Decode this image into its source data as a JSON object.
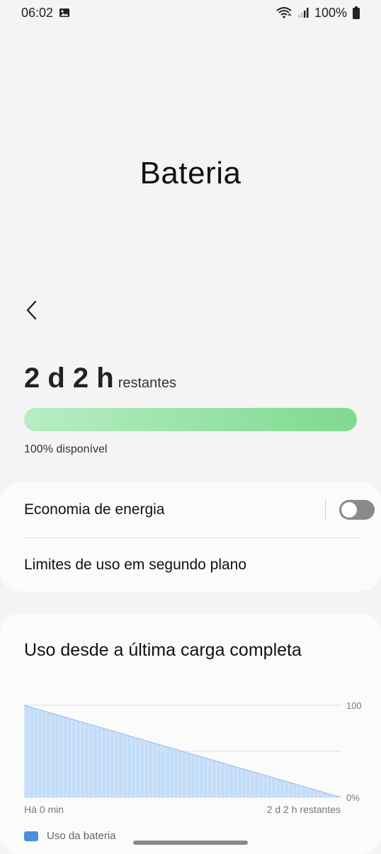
{
  "status_bar": {
    "time": "06:02",
    "battery_percent": "100%",
    "icons": [
      "gallery-notification-icon",
      "wifi-icon",
      "cell-signal-icon",
      "battery-icon"
    ]
  },
  "header": {
    "title": "Bateria",
    "back_icon": "chevron-left-icon"
  },
  "battery": {
    "remaining_value": "2 d 2 h",
    "remaining_suffix": "restantes",
    "level_percent": 100,
    "available_text": "100% disponível",
    "bar_color_start": "#b7edc4",
    "bar_color_end": "#7fd98f"
  },
  "settings": {
    "power_saving_label": "Economia de energia",
    "power_saving_enabled": false,
    "background_limits_label": "Limites de uso em segundo plano"
  },
  "usage": {
    "title": "Uso desde a última carga completa",
    "legend_label": "Uso da bateria",
    "legend_color": "#4a90d9"
  },
  "chart_data": {
    "type": "area",
    "x": [
      "Há 0 min",
      "2 d 2 h restantes"
    ],
    "y": [
      100,
      0
    ],
    "ylim": [
      0,
      100
    ],
    "y_ticks": [
      "0%",
      "100"
    ],
    "x_labels": [
      "Há 0 min",
      "2 d 2 h restantes"
    ],
    "grid": true,
    "fill_color": "#bcd8f7"
  }
}
